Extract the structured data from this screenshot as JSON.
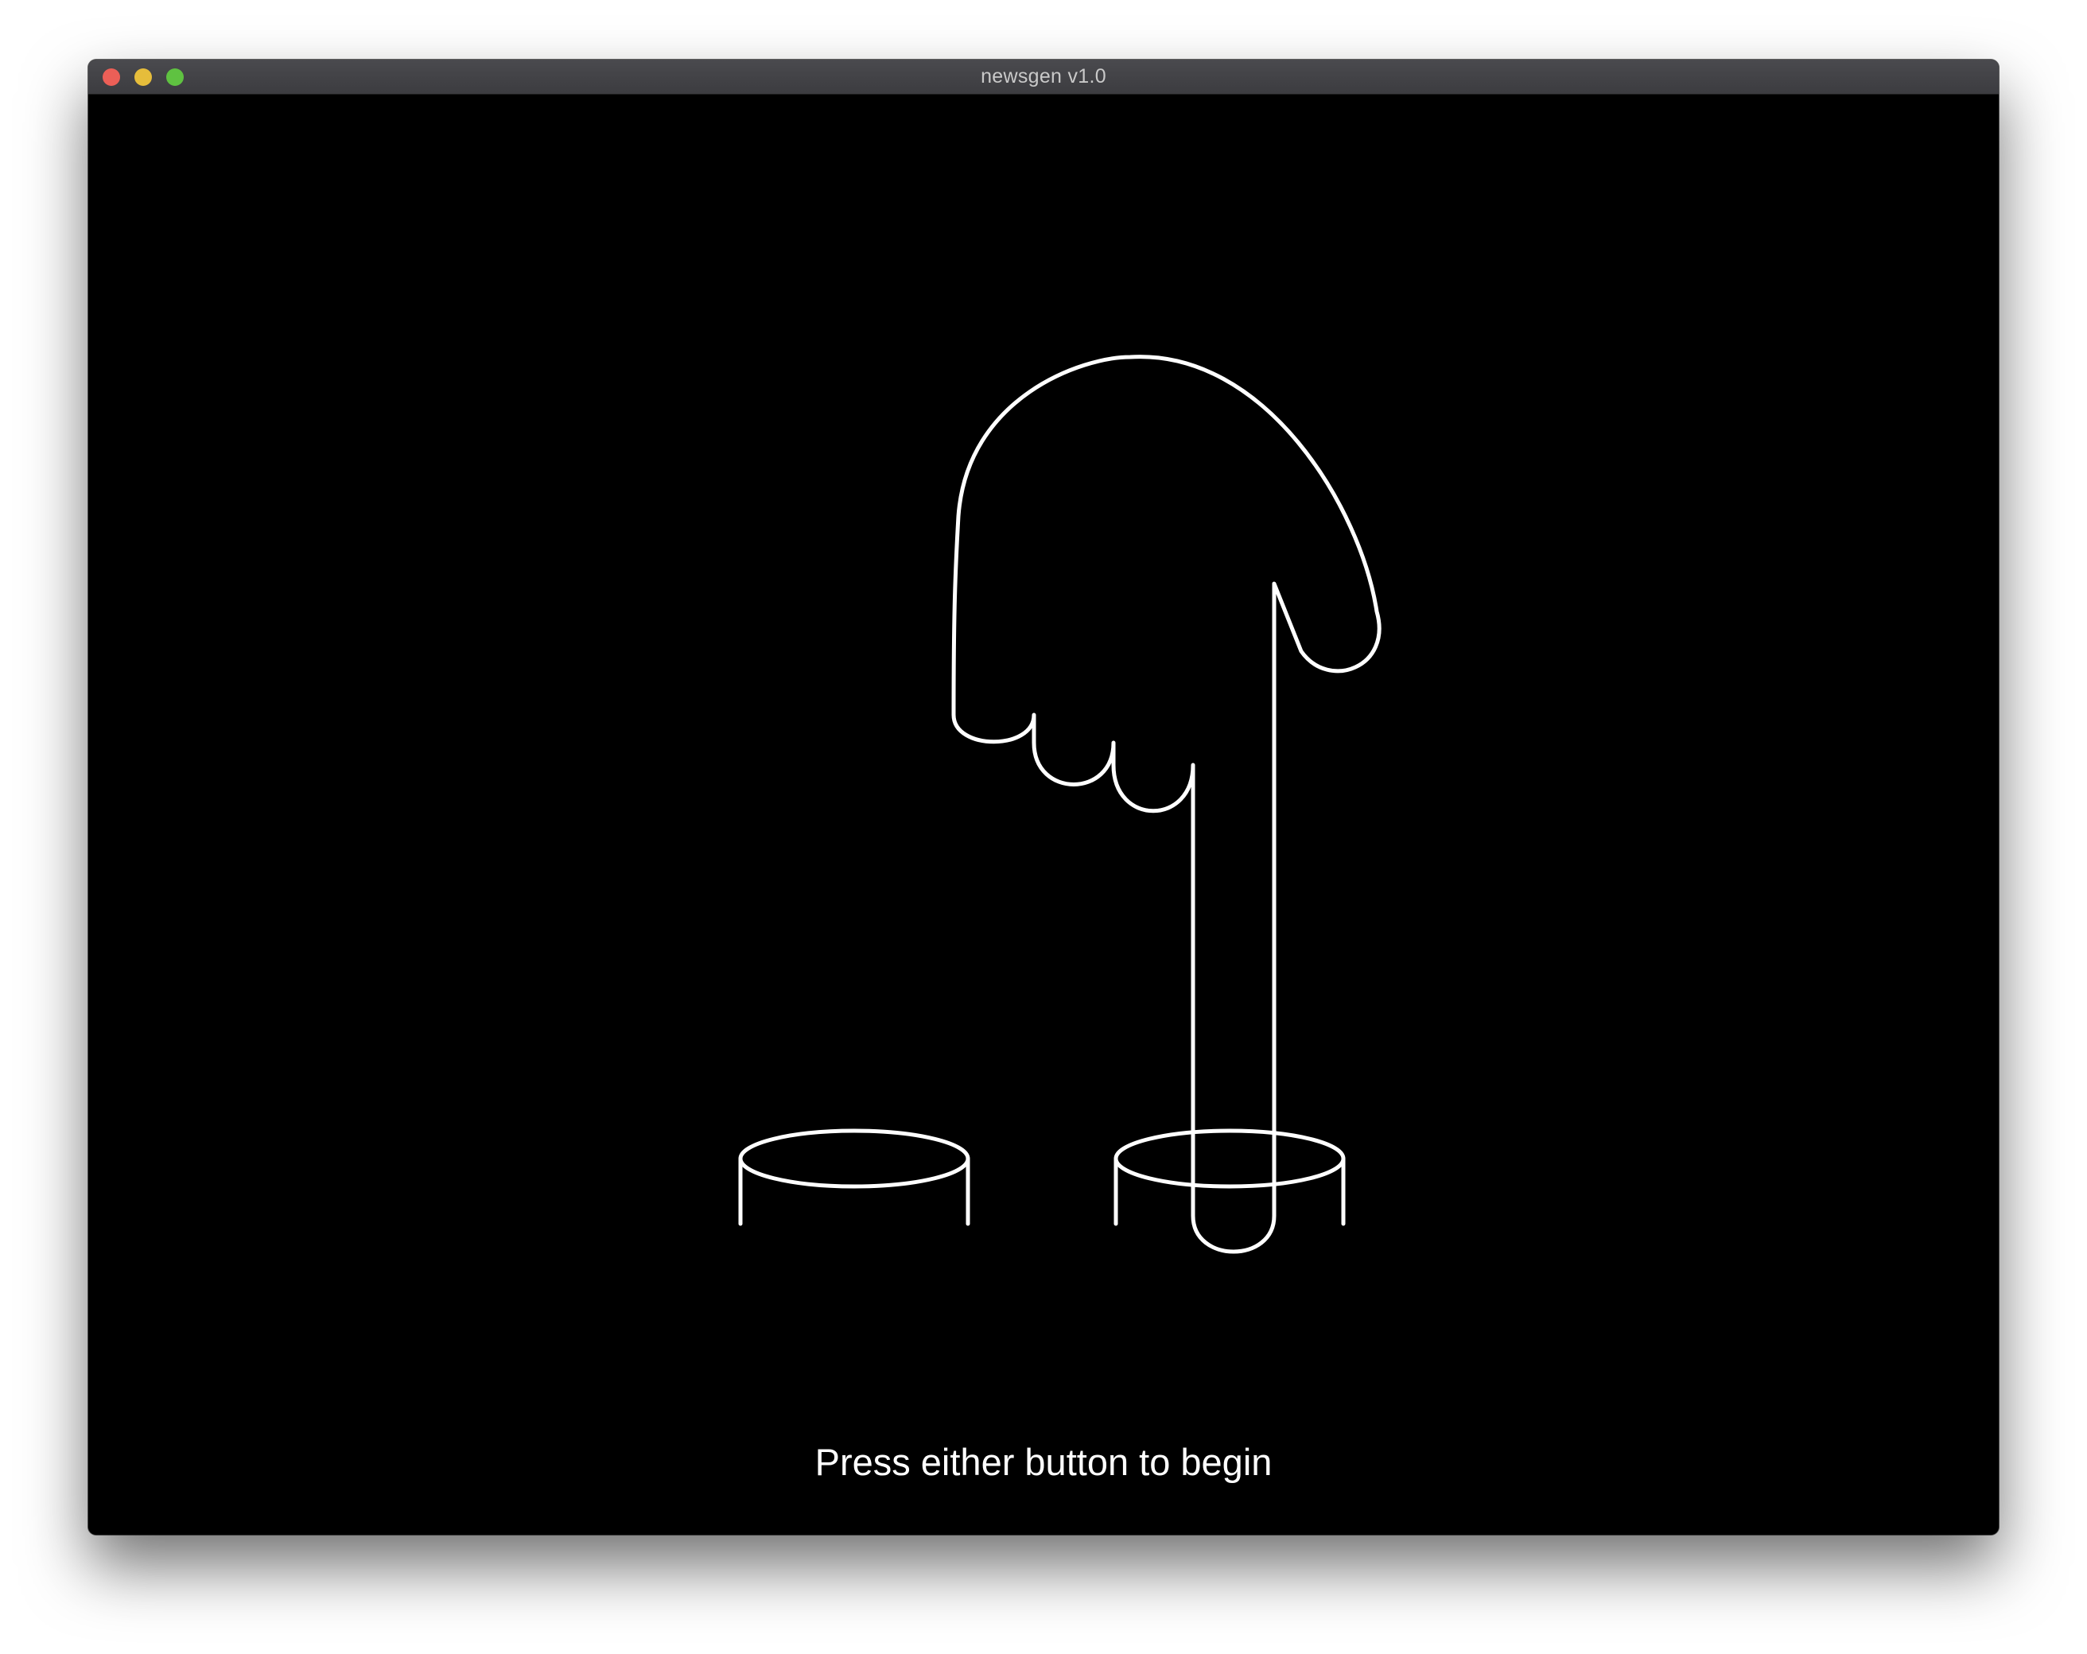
{
  "window": {
    "title": "newsgen v1.0",
    "controls": {
      "close_color": "#ec5f57",
      "minimize_color": "#e6bd3b",
      "zoom_color": "#5fc241"
    }
  },
  "main": {
    "instruction": "Press either button to begin",
    "illustration": {
      "hand_icon": "pointing-down-hand-icon",
      "buttons": [
        "left-push-button-icon",
        "right-push-button-icon"
      ],
      "stroke_color": "#ffffff",
      "background_color": "#000000"
    }
  }
}
